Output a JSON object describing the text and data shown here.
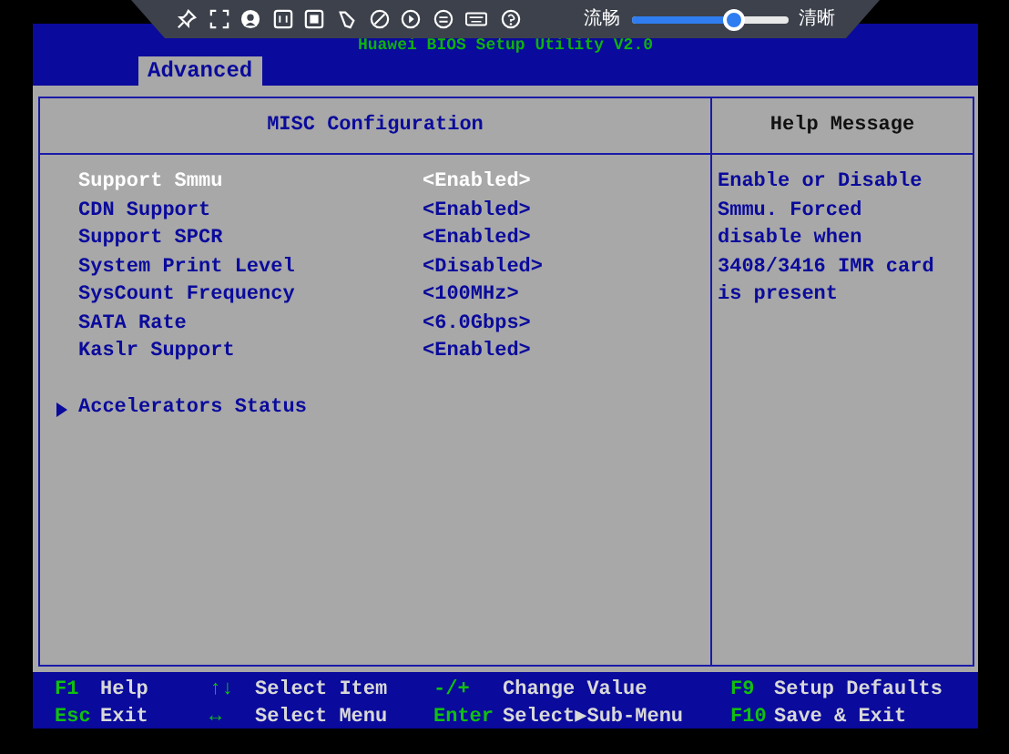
{
  "toolbar": {
    "quality_low": "流畅",
    "quality_slider": {
      "level": 0.66
    },
    "quality_high": "清晰"
  },
  "title": "Huawei BIOS Setup Utility V2.0",
  "tabs": [
    {
      "label": "Advanced",
      "selected": true
    }
  ],
  "panel": {
    "title": "MISC Configuration",
    "items": [
      {
        "kind": "setting",
        "label": "Support Smmu",
        "value": "<Enabled>",
        "selected": true
      },
      {
        "kind": "setting",
        "label": "CDN Support",
        "value": "<Enabled>",
        "selected": false
      },
      {
        "kind": "setting",
        "label": "Support SPCR",
        "value": "<Enabled>",
        "selected": false
      },
      {
        "kind": "setting",
        "label": "System Print Level",
        "value": "<Disabled>",
        "selected": false
      },
      {
        "kind": "setting",
        "label": "SysCount Frequency",
        "value": "<100MHz>",
        "selected": false
      },
      {
        "kind": "setting",
        "label": "SATA Rate",
        "value": "<6.0Gbps>",
        "selected": false
      },
      {
        "kind": "setting",
        "label": "Kaslr Support",
        "value": "<Enabled>",
        "selected": false
      },
      {
        "kind": "submenu",
        "label": "Accelerators Status",
        "selected": false
      }
    ]
  },
  "help": {
    "title": "Help Message",
    "text": "Enable or Disable Smmu. Forced disable when 3408/3416 IMR card is present"
  },
  "footer": [
    {
      "key": "F1",
      "action": "Help"
    },
    {
      "key": "↑↓",
      "action": "Select Item"
    },
    {
      "key": "-/+",
      "action": "Change Value"
    },
    {
      "key": "F9",
      "action": "Setup Defaults"
    },
    {
      "key": "Esc",
      "action": "Exit"
    },
    {
      "key": "↔",
      "action": "Select Menu"
    },
    {
      "key": "Enter",
      "action": "Select▶Sub-Menu"
    },
    {
      "key": "F10",
      "action": "Save & Exit"
    }
  ]
}
